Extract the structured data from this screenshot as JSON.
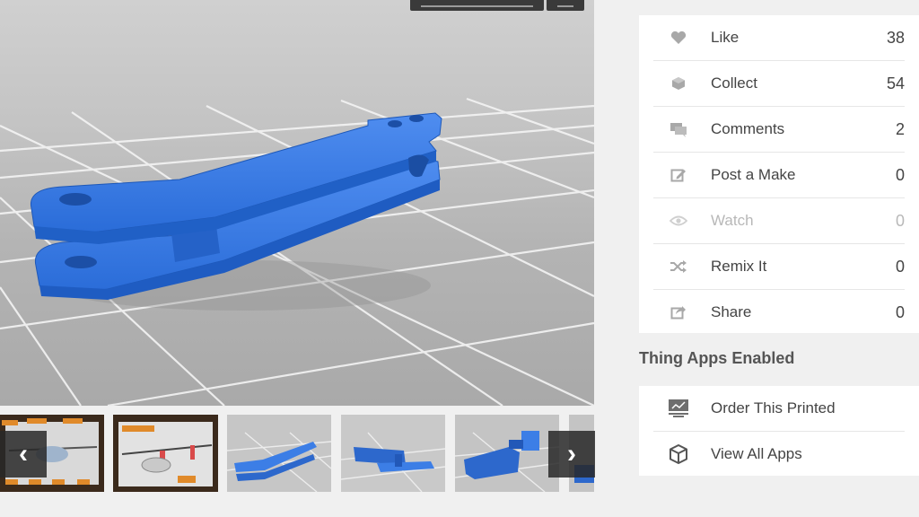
{
  "stats": [
    {
      "label": "Like",
      "count": "38",
      "icon": "heart-icon"
    },
    {
      "label": "Collect",
      "count": "54",
      "icon": "collect-icon"
    },
    {
      "label": "Comments",
      "count": "2",
      "icon": "comment-icon"
    },
    {
      "label": "Post a Make",
      "count": "0",
      "icon": "edit-icon"
    },
    {
      "label": "Watch",
      "count": "0",
      "icon": "eye-icon"
    },
    {
      "label": "Remix It",
      "count": "0",
      "icon": "shuffle-icon"
    },
    {
      "label": "Share",
      "count": "0",
      "icon": "share-icon"
    }
  ],
  "apps_section": {
    "title": "Thing Apps Enabled"
  },
  "apps": [
    {
      "label": "Order This Printed",
      "icon": "printer-icon"
    },
    {
      "label": "View All Apps",
      "icon": "cube-icon"
    }
  ],
  "colors": {
    "model_blue": "#2b6fd6",
    "icon_gray": "#a8a8a8",
    "panel_bg": "#f0f0f0"
  }
}
